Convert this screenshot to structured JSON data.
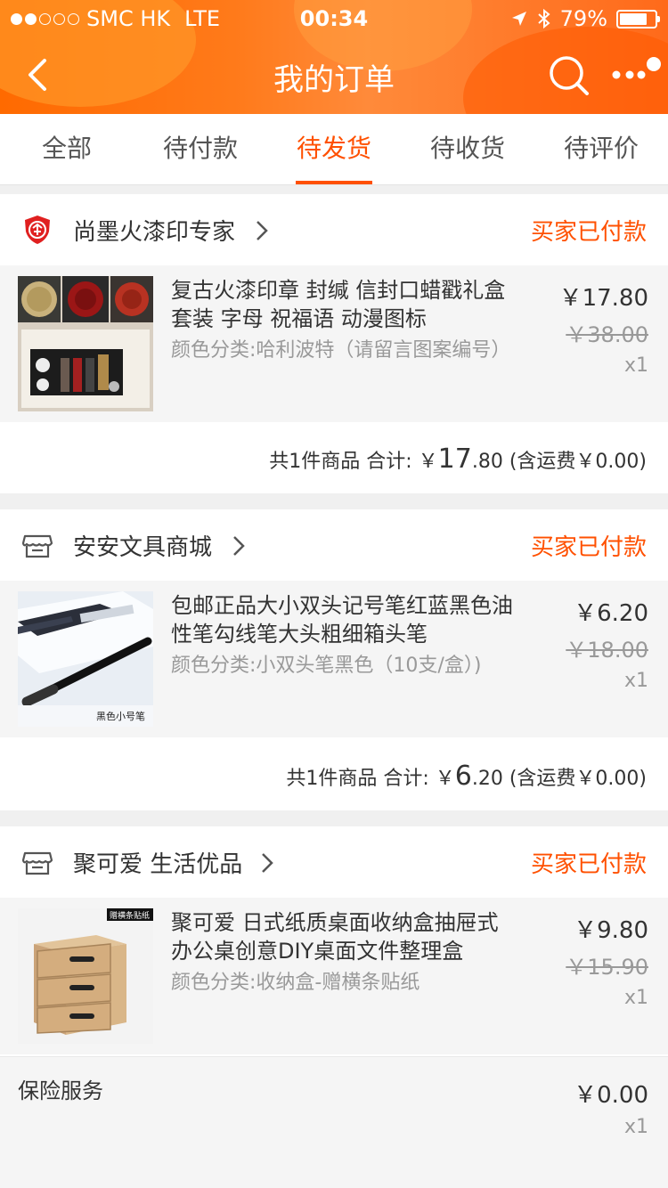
{
  "status_bar": {
    "carrier": "SMC HK",
    "network": "LTE",
    "time": "00:34",
    "battery": "79%",
    "battery_level": 0.79
  },
  "navbar": {
    "title": "我的订单",
    "back_icon": "chevron-left-icon",
    "search_icon": "search-icon",
    "more_icon": "more-dots-icon"
  },
  "tabs": [
    {
      "label": "全部",
      "active": false
    },
    {
      "label": "待付款",
      "active": false
    },
    {
      "label": "待发货",
      "active": true
    },
    {
      "label": "待收货",
      "active": false
    },
    {
      "label": "待评价",
      "active": false
    }
  ],
  "orders": [
    {
      "shop": "尚墨火漆印专家",
      "shop_icon": "enterprise-shield-icon",
      "status": "买家已付款",
      "item": {
        "title": "复古火漆印章 封缄 信封口蜡戳礼盒套装 字母 祝福语 动漫图标",
        "spec": "颜色分类:哈利波特（请留言图案编号）",
        "price": "￥17.80",
        "original_price": "￥38.00",
        "qty": "x1",
        "image": "wax-seal-kit-image"
      },
      "summary": {
        "count": "共1件商品 合计:",
        "currency": "￥",
        "amount_int": "17",
        "amount_dec": ".80",
        "shipping": "(含运费￥0.00)"
      }
    },
    {
      "shop": "安安文具商城",
      "shop_icon": "store-icon",
      "status": "买家已付款",
      "item": {
        "title": "包邮正品大小双头记号笔红蓝黑色油性笔勾线笔大头粗细箱头笔",
        "spec": "颜色分类:小双头笔黑色（10支/盒）)",
        "price": "￥6.20",
        "original_price": "￥18.00",
        "qty": "x1",
        "image": "marker-pen-box-image",
        "image_caption": "黑色小号笔"
      },
      "summary": {
        "count": "共1件商品 合计:",
        "currency": "￥",
        "amount_int": "6",
        "amount_dec": ".20",
        "shipping": "(含运费￥0.00)"
      }
    },
    {
      "shop": "聚可爱 生活优品",
      "shop_icon": "store-icon",
      "status": "买家已付款",
      "item": {
        "title": "聚可爱 日式纸质桌面收纳盒抽屉式办公桌创意DIY桌面文件整理盒",
        "spec": "颜色分类:收纳盒-赠横条贴纸",
        "price": "￥9.80",
        "original_price": "￥15.90",
        "qty": "x1",
        "image": "kraft-drawer-box-image",
        "image_caption": "赠横条贴纸"
      }
    }
  ],
  "service": {
    "label": "保险服务",
    "price": "￥0.00",
    "qty": "x1"
  },
  "colors": {
    "accent": "#ff5000",
    "header": "#ff7a1a"
  }
}
